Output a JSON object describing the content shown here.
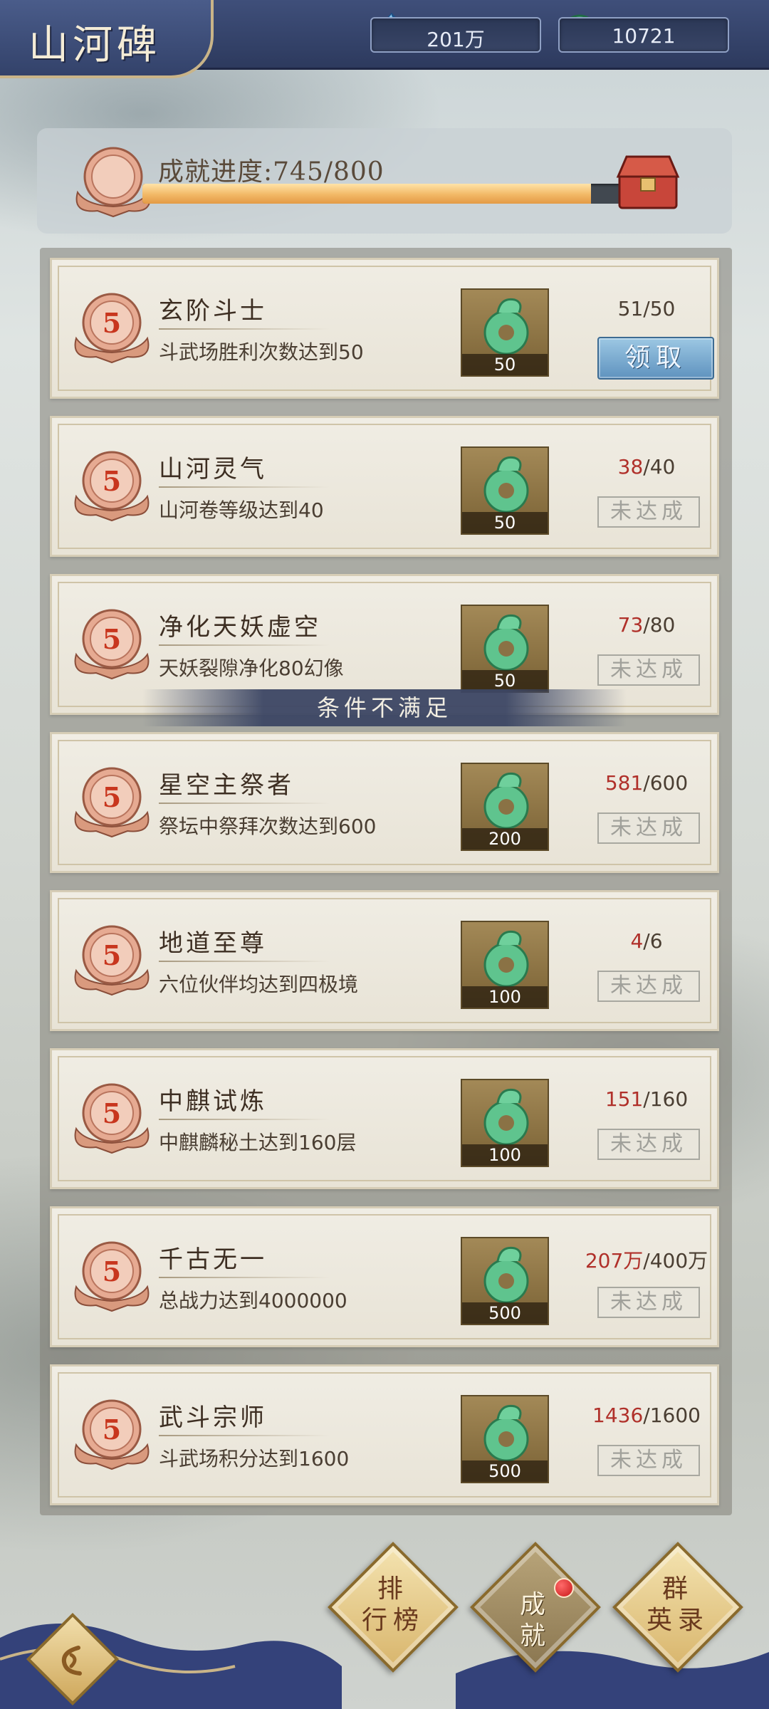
{
  "header": {
    "title": "山河碑",
    "resources": [
      {
        "icon": "crystal-icon",
        "value": "201万"
      },
      {
        "icon": "jade-coin-icon",
        "value": "10721"
      }
    ]
  },
  "progress": {
    "label": "成就进度:745/800",
    "current": 745,
    "total": 800,
    "chest_icon": "treasure-chest-icon"
  },
  "achievements": [
    {
      "level": "5",
      "name": "玄阶斗士",
      "desc": "斗武场胜利次数达到50",
      "reward": "50",
      "cur": "51",
      "total": "/50",
      "done": true,
      "action": "领取"
    },
    {
      "level": "5",
      "name": "山河灵气",
      "desc": "山河卷等级达到40",
      "reward": "50",
      "cur": "38",
      "total": "/40",
      "done": false,
      "action": "未达成"
    },
    {
      "level": "5",
      "name": "净化天妖虚空",
      "desc": "天妖裂隙净化80幻像",
      "reward": "50",
      "cur": "73",
      "total": "/80",
      "done": false,
      "action": "未达成"
    },
    {
      "level": "5",
      "name": "星空主祭者",
      "desc": "祭坛中祭拜次数达到600",
      "reward": "200",
      "cur": "581",
      "total": "/600",
      "done": false,
      "action": "未达成"
    },
    {
      "level": "5",
      "name": "地道至尊",
      "desc": "六位伙伴均达到四极境",
      "reward": "100",
      "cur": "4",
      "total": "/6",
      "done": false,
      "action": "未达成"
    },
    {
      "level": "5",
      "name": "中麒试炼",
      "desc": "中麒麟秘土达到160层",
      "reward": "100",
      "cur": "151",
      "total": "/160",
      "done": false,
      "action": "未达成"
    },
    {
      "level": "5",
      "name": "千古无一",
      "desc": "总战力达到4000000",
      "reward": "500",
      "cur": "207万",
      "total": "/400万",
      "done": false,
      "action": "未达成"
    },
    {
      "level": "5",
      "name": "武斗宗师",
      "desc": "斗武场积分达到1600",
      "reward": "500",
      "cur": "1436",
      "total": "/1600",
      "done": false,
      "action": "未达成"
    }
  ],
  "condition_banner": "条件不满足",
  "nav": {
    "back_icon": "back-arrow-icon",
    "ranking": "排行榜",
    "achievement": "成就",
    "heroes": "群英录"
  },
  "colors": {
    "header": "#33426a",
    "progress_fill": "#f2b866",
    "unfinished_count": "#b0302a",
    "claim_button": "#5f93bf"
  }
}
